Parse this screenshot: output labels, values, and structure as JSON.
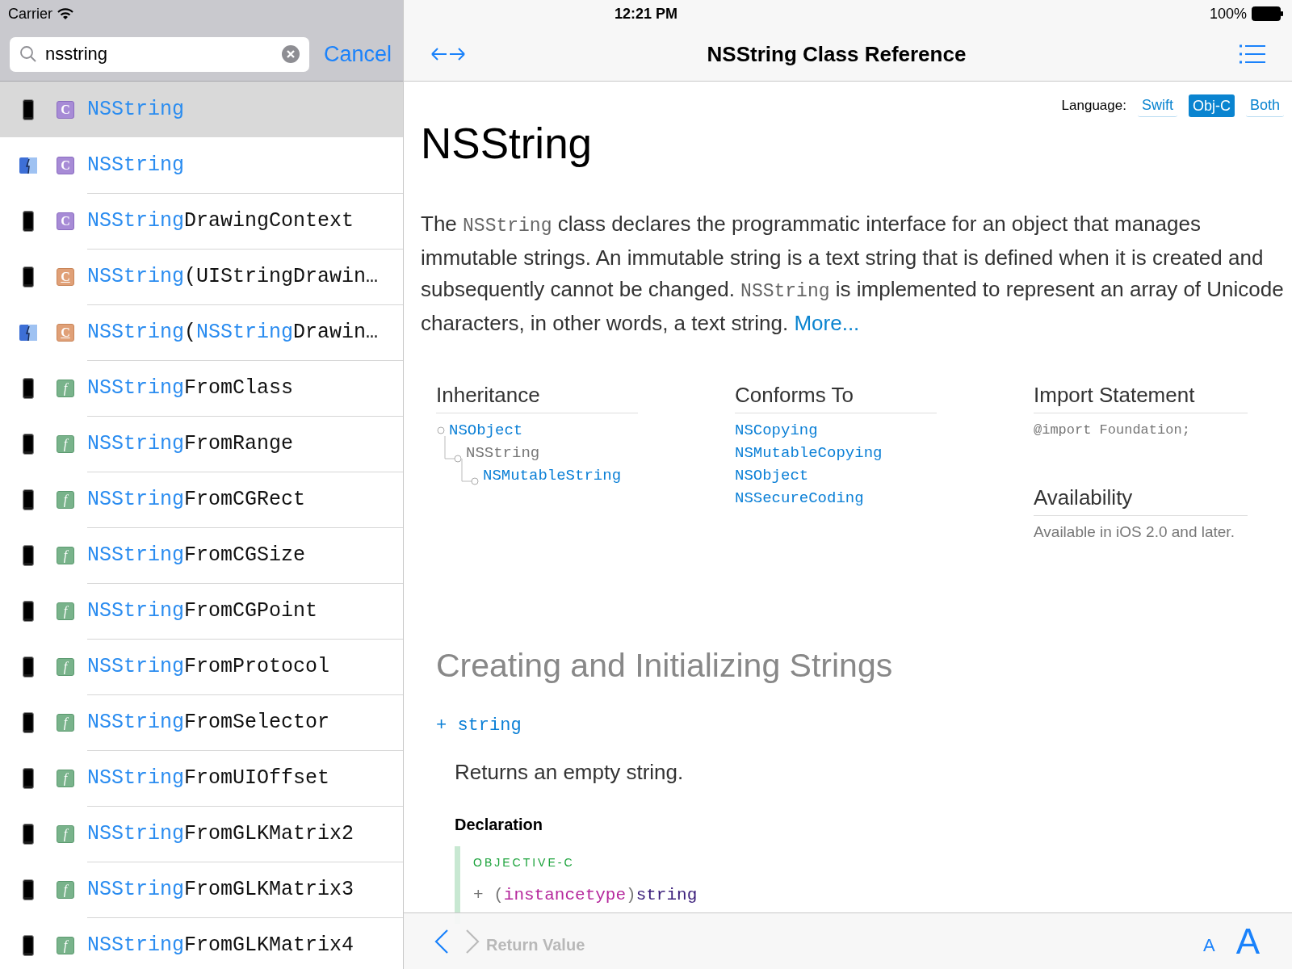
{
  "status_bar": {
    "carrier": "Carrier",
    "time": "12:21 PM",
    "battery": "100%"
  },
  "search": {
    "value": "nsstring",
    "cancel": "Cancel"
  },
  "results": [
    {
      "device": {
        "kind": "ios"
      },
      "badge": {
        "kind": "class",
        "text": "C"
      },
      "selected": true,
      "parts": [
        {
          "text": "NSString",
          "match": true
        }
      ]
    },
    {
      "device": {
        "kind": "mac"
      },
      "badge": {
        "kind": "class",
        "text": "C"
      },
      "selected": false,
      "parts": [
        {
          "text": "NSString",
          "match": true
        }
      ]
    },
    {
      "device": {
        "kind": "ios"
      },
      "badge": {
        "kind": "class",
        "text": "C"
      },
      "selected": false,
      "parts": [
        {
          "text": "NSString",
          "match": true
        },
        {
          "text": "DrawingContext",
          "match": false
        }
      ]
    },
    {
      "device": {
        "kind": "ios"
      },
      "badge": {
        "kind": "category",
        "text": "C"
      },
      "selected": false,
      "parts": [
        {
          "text": "NSString",
          "match": true
        },
        {
          "text": "(UIStringDrawin…",
          "match": false
        }
      ]
    },
    {
      "device": {
        "kind": "mac"
      },
      "badge": {
        "kind": "category",
        "text": "C"
      },
      "selected": false,
      "parts": [
        {
          "text": "NSString",
          "match": true
        },
        {
          "text": "(",
          "match": false
        },
        {
          "text": "NSString",
          "match": true
        },
        {
          "text": "Drawin…",
          "match": false
        }
      ]
    },
    {
      "device": {
        "kind": "ios"
      },
      "badge": {
        "kind": "function",
        "text": "f"
      },
      "selected": false,
      "parts": [
        {
          "text": "NSString",
          "match": true
        },
        {
          "text": "FromClass",
          "match": false
        }
      ]
    },
    {
      "device": {
        "kind": "ios"
      },
      "badge": {
        "kind": "function",
        "text": "f"
      },
      "selected": false,
      "parts": [
        {
          "text": "NSString",
          "match": true
        },
        {
          "text": "FromRange",
          "match": false
        }
      ]
    },
    {
      "device": {
        "kind": "ios"
      },
      "badge": {
        "kind": "function",
        "text": "f"
      },
      "selected": false,
      "parts": [
        {
          "text": "NSString",
          "match": true
        },
        {
          "text": "FromCGRect",
          "match": false
        }
      ]
    },
    {
      "device": {
        "kind": "ios"
      },
      "badge": {
        "kind": "function",
        "text": "f"
      },
      "selected": false,
      "parts": [
        {
          "text": "NSString",
          "match": true
        },
        {
          "text": "FromCGSize",
          "match": false
        }
      ]
    },
    {
      "device": {
        "kind": "ios"
      },
      "badge": {
        "kind": "function",
        "text": "f"
      },
      "selected": false,
      "parts": [
        {
          "text": "NSString",
          "match": true
        },
        {
          "text": "FromCGPoint",
          "match": false
        }
      ]
    },
    {
      "device": {
        "kind": "ios"
      },
      "badge": {
        "kind": "function",
        "text": "f"
      },
      "selected": false,
      "parts": [
        {
          "text": "NSString",
          "match": true
        },
        {
          "text": "FromProtocol",
          "match": false
        }
      ]
    },
    {
      "device": {
        "kind": "ios"
      },
      "badge": {
        "kind": "function",
        "text": "f"
      },
      "selected": false,
      "parts": [
        {
          "text": "NSString",
          "match": true
        },
        {
          "text": "FromSelector",
          "match": false
        }
      ]
    },
    {
      "device": {
        "kind": "ios"
      },
      "badge": {
        "kind": "function",
        "text": "f"
      },
      "selected": false,
      "parts": [
        {
          "text": "NSString",
          "match": true
        },
        {
          "text": "FromUIOffset",
          "match": false
        }
      ]
    },
    {
      "device": {
        "kind": "ios"
      },
      "badge": {
        "kind": "function",
        "text": "f"
      },
      "selected": false,
      "parts": [
        {
          "text": "NSString",
          "match": true
        },
        {
          "text": "FromGLKMatrix2",
          "match": false
        }
      ]
    },
    {
      "device": {
        "kind": "ios"
      },
      "badge": {
        "kind": "function",
        "text": "f"
      },
      "selected": false,
      "parts": [
        {
          "text": "NSString",
          "match": true
        },
        {
          "text": "FromGLKMatrix3",
          "match": false
        }
      ]
    },
    {
      "device": {
        "kind": "ios"
      },
      "badge": {
        "kind": "function",
        "text": "f"
      },
      "selected": false,
      "parts": [
        {
          "text": "NSString",
          "match": true
        },
        {
          "text": "FromGLKMatrix4",
          "match": false
        }
      ]
    }
  ],
  "nav": {
    "title": "NSString Class Reference"
  },
  "language": {
    "label": "Language:",
    "options": [
      {
        "label": "Swift",
        "selected": false
      },
      {
        "label": "Obj-C",
        "selected": true
      },
      {
        "label": "Both",
        "selected": false
      }
    ]
  },
  "doc": {
    "title": "NSString",
    "overview": [
      {
        "kind": "text",
        "text": "The "
      },
      {
        "kind": "code",
        "text": "NSString"
      },
      {
        "kind": "text",
        "text": " class declares the programmatic interface for an object that manages immutable strings. An immutable string is a text string that is defined when it is created and subsequently cannot be changed. "
      },
      {
        "kind": "code",
        "text": "NSString"
      },
      {
        "kind": "text",
        "text": " is implemented to represent an array of Unicode characters, in other words, a text string. "
      },
      {
        "kind": "link",
        "text": "More..."
      }
    ],
    "inheritance": {
      "heading": "Inheritance",
      "tree": [
        {
          "name": "NSObject",
          "link": true,
          "children": [
            {
              "name": "NSString",
              "link": false,
              "children": [
                {
                  "name": "NSMutableString",
                  "link": true
                }
              ]
            }
          ]
        }
      ]
    },
    "conforms_to": {
      "heading": "Conforms To",
      "items": [
        "NSCopying",
        "NSMutableCopying",
        "NSObject",
        "NSSecureCoding"
      ]
    },
    "import_statement": {
      "heading": "Import Statement",
      "code": "@import Foundation;"
    },
    "availability": {
      "heading": "Availability",
      "text": "Available in iOS 2.0 and later."
    },
    "section": {
      "title": "Creating and Initializing Strings",
      "method": "+ string",
      "summary": "Returns an empty string.",
      "declaration_heading": "Declaration",
      "language_label": "OBJECTIVE-C",
      "code": [
        {
          "kind": "punct",
          "text": "+ ("
        },
        {
          "kind": "keyword",
          "text": "instancetype"
        },
        {
          "kind": "punct",
          "text": ")"
        },
        {
          "kind": "name",
          "text": "string"
        }
      ],
      "next_heading": "Return Value"
    }
  },
  "toolbar": {
    "back_enabled": true,
    "forward_enabled": false,
    "small_font": "A",
    "large_font": "A"
  }
}
